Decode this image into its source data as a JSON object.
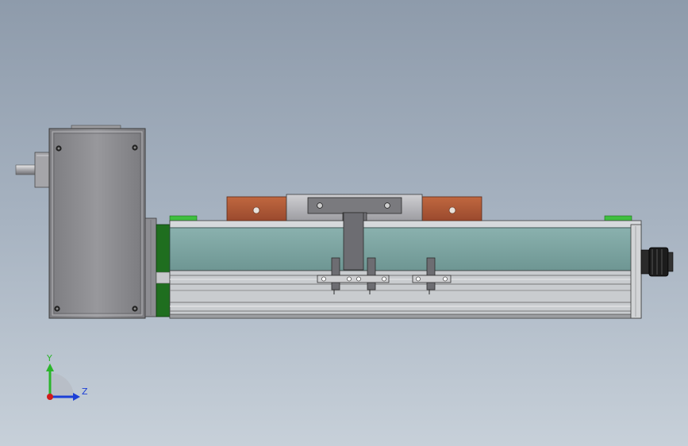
{
  "triad": {
    "y_label": "Y",
    "z_label": "Z",
    "colors": {
      "y": "#2bb52b",
      "z": "#1c3fd6",
      "origin": "#d11a1a"
    }
  },
  "colors": {
    "background_top": "#8e9bab",
    "background_bottom": "#c5ced8",
    "rail_body": "#7aa3a0",
    "motor_housing": "#8a8a8e",
    "carriage_plate": "#b0553a",
    "end_cap": "#1e6f1e",
    "green_tab": "#3fbf3f",
    "connector": "#1e1e1e"
  },
  "parts": {
    "gear_motor": "gear-motor",
    "linear_module": "linear-module",
    "carriage": "slide-carriage",
    "sensors": [
      "limit-sensor-1",
      "limit-sensor-2",
      "limit-sensor-3"
    ],
    "cable_connector": "cable-connector"
  }
}
